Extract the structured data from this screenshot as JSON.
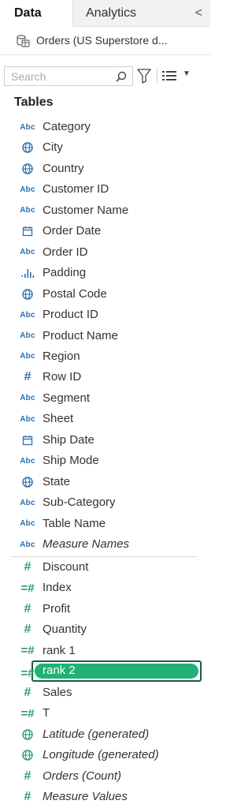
{
  "tabs": {
    "data_label": "Data",
    "analytics_label": "Analytics",
    "collapse_glyph": "<"
  },
  "datasource": {
    "label": "Orders (US Superstore d...",
    "icon": "datasource-icon"
  },
  "search": {
    "placeholder": "Search"
  },
  "tables_heading": "Tables",
  "dimensions": [
    {
      "name": "Category",
      "type": "abc"
    },
    {
      "name": "City",
      "type": "globe"
    },
    {
      "name": "Country",
      "type": "globe"
    },
    {
      "name": "Customer ID",
      "type": "abc"
    },
    {
      "name": "Customer Name",
      "type": "abc"
    },
    {
      "name": "Order Date",
      "type": "calendar"
    },
    {
      "name": "Order ID",
      "type": "abc"
    },
    {
      "name": "Padding",
      "type": "bins"
    },
    {
      "name": "Postal Code",
      "type": "globe"
    },
    {
      "name": "Product ID",
      "type": "abc"
    },
    {
      "name": "Product Name",
      "type": "abc"
    },
    {
      "name": "Region",
      "type": "abc"
    },
    {
      "name": "Row ID",
      "type": "hash-blue"
    },
    {
      "name": "Segment",
      "type": "abc"
    },
    {
      "name": "Sheet",
      "type": "abc"
    },
    {
      "name": "Ship Date",
      "type": "calendar"
    },
    {
      "name": "Ship Mode",
      "type": "abc"
    },
    {
      "name": "State",
      "type": "globe"
    },
    {
      "name": "Sub-Category",
      "type": "abc"
    },
    {
      "name": "Table Name",
      "type": "abc"
    },
    {
      "name": "Measure Names",
      "type": "abc",
      "italic": true
    }
  ],
  "measures": [
    {
      "name": "Discount",
      "type": "hash"
    },
    {
      "name": "Index",
      "type": "calc-hash"
    },
    {
      "name": "Profit",
      "type": "hash"
    },
    {
      "name": "Quantity",
      "type": "hash"
    },
    {
      "name": "rank 1",
      "type": "calc-hash"
    },
    {
      "name": "rank 2",
      "type": "calc-hash",
      "selected": true
    },
    {
      "name": "Sales",
      "type": "hash"
    },
    {
      "name": "T",
      "type": "calc-hash"
    },
    {
      "name": "Latitude (generated)",
      "type": "globe-green",
      "italic": true
    },
    {
      "name": "Longitude (generated)",
      "type": "globe-green",
      "italic": true
    },
    {
      "name": "Orders (Count)",
      "type": "hash",
      "italic": true
    },
    {
      "name": "Measure Values",
      "type": "hash",
      "italic": true
    }
  ],
  "colors": {
    "dimension": "#2a70b0",
    "measure": "#2a9d6b",
    "selected_fill": "#21b173",
    "selected_border": "#1a5c4a"
  }
}
